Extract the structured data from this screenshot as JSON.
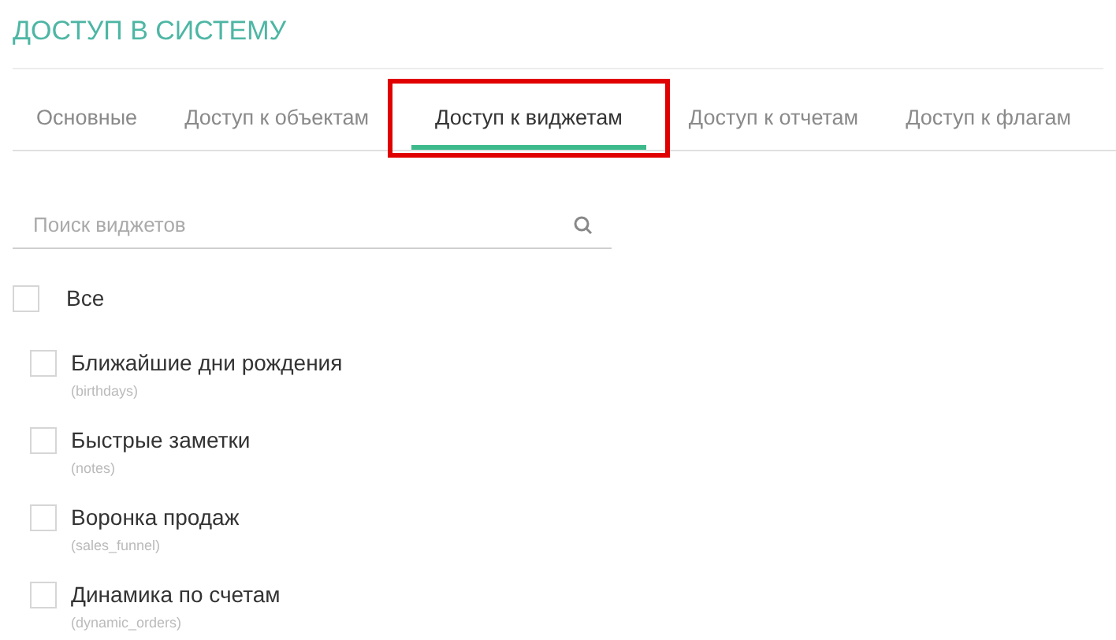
{
  "title": "ДОСТУП В СИСТЕМУ",
  "tabs": [
    {
      "label": "Основные",
      "selected": false,
      "annotated": false
    },
    {
      "label": "Доступ к объектам",
      "selected": false,
      "annotated": false
    },
    {
      "label": "Доступ к виджетам",
      "selected": true,
      "annotated": true
    },
    {
      "label": "Доступ к отчетам",
      "selected": false,
      "annotated": false
    },
    {
      "label": "Доступ к флагам",
      "selected": false,
      "annotated": false
    }
  ],
  "search": {
    "placeholder": "Поиск виджетов"
  },
  "all": {
    "label": "Все",
    "checked": false
  },
  "widgets": [
    {
      "name": "Ближайшие дни рождения",
      "code": "(birthdays)",
      "checked": false
    },
    {
      "name": "Быстрые заметки",
      "code": "(notes)",
      "checked": false
    },
    {
      "name": "Воронка продаж",
      "code": "(sales_funnel)",
      "checked": false
    },
    {
      "name": "Динамика по счетам",
      "code": "(dynamic_orders)",
      "checked": false
    }
  ]
}
